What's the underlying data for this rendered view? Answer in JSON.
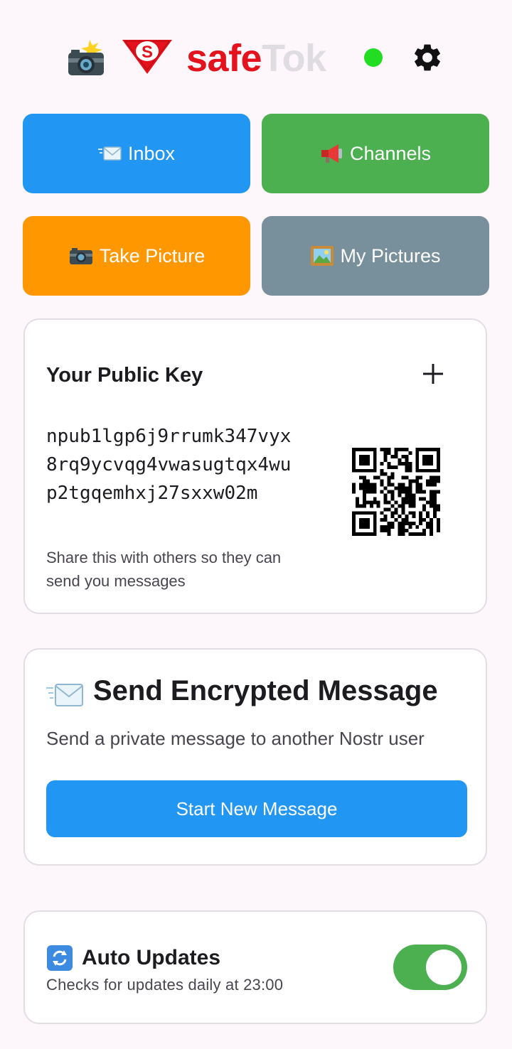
{
  "header": {
    "camera_icon": "camera-flash-icon",
    "logo_icon": "shield-s-icon",
    "brand_part1": "safe",
    "brand_part2": "Tok",
    "status_color": "#22dd22",
    "settings_icon": "gear-icon"
  },
  "buttons": {
    "inbox": "Inbox",
    "channels": "Channels",
    "take_picture": "Take Picture",
    "my_pictures": "My Pictures"
  },
  "public_key": {
    "title": "Your Public Key",
    "key": "npub1lgp6j9rrumk347vyx8rq9ycvqg4vwasugtqx4wup2tgqemhxj27sxxw02m",
    "hint": "Share this with others so they can send you messages"
  },
  "send": {
    "title": "Send Encrypted Message",
    "subtitle": "Send a private message to another Nostr user",
    "button": "Start New Message"
  },
  "updates": {
    "title": "Auto Updates",
    "subtitle": "Checks for updates daily at 23:00",
    "enabled": true
  },
  "colors": {
    "primary": "#2196f3",
    "green": "#4caf50",
    "orange": "#ff9800",
    "grey": "#78909c",
    "brand_red": "#e3121c"
  }
}
